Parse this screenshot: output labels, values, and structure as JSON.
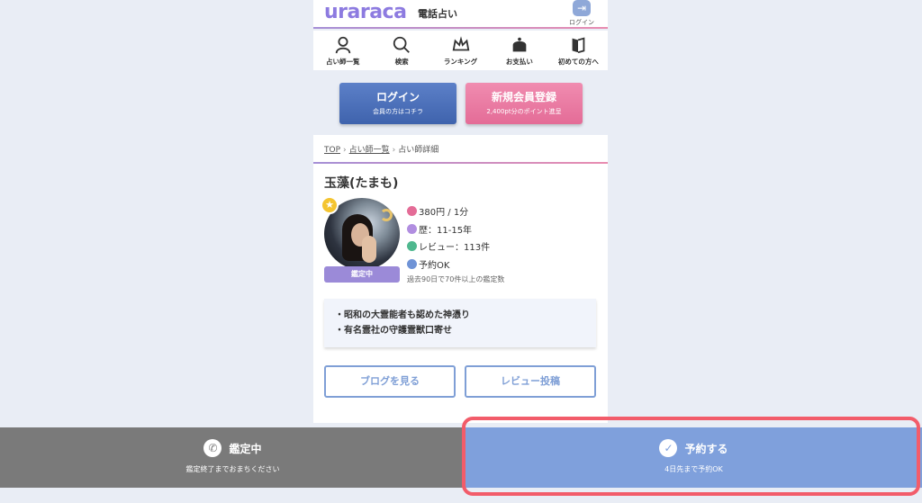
{
  "header": {
    "logo": "uraraca",
    "logo_sub": "電話占い",
    "login_label": "ログイン"
  },
  "nav": [
    {
      "label": "占い師一覧",
      "icon": "fortune-teller-icon"
    },
    {
      "label": "検索",
      "icon": "search-icon"
    },
    {
      "label": "ランキング",
      "icon": "crown-icon"
    },
    {
      "label": "お支払い",
      "icon": "wallet-icon"
    },
    {
      "label": "初めての方へ",
      "icon": "book-icon"
    }
  ],
  "auth": {
    "login_main": "ログイン",
    "login_sub": "会員の方はコチラ",
    "register_main": "新規会員登録",
    "register_sub": "2,400pt分のポイント進呈"
  },
  "breadcrumb": {
    "top": "TOP",
    "list": "占い師一覧",
    "current": "占い師詳細"
  },
  "profile": {
    "name": "玉藻(たまも)",
    "status": "鑑定中",
    "price": "380円 / 1分",
    "experience": "歴：11-15年",
    "reviews": "レビュー：113件",
    "reservation": "予約OK",
    "note": "過去90日で70件以上の鑑定数",
    "catch_1": "・昭和の大霊能者も認めた神憑り",
    "catch_2": "・有名霊社の守護霊獣口寄せ"
  },
  "actions": {
    "blog": "ブログを見る",
    "review": "レビュー投稿"
  },
  "bottom": {
    "left_main": "鑑定中",
    "left_sub": "鑑定終了までおまちください",
    "right_main": "予約する",
    "right_sub": "4日先まで予約OK"
  },
  "colors": {
    "accent_blue": "#7fa0dc",
    "accent_purple": "#9b8ad8",
    "accent_pink": "#e46c97",
    "highlight": "#f25c6a"
  }
}
